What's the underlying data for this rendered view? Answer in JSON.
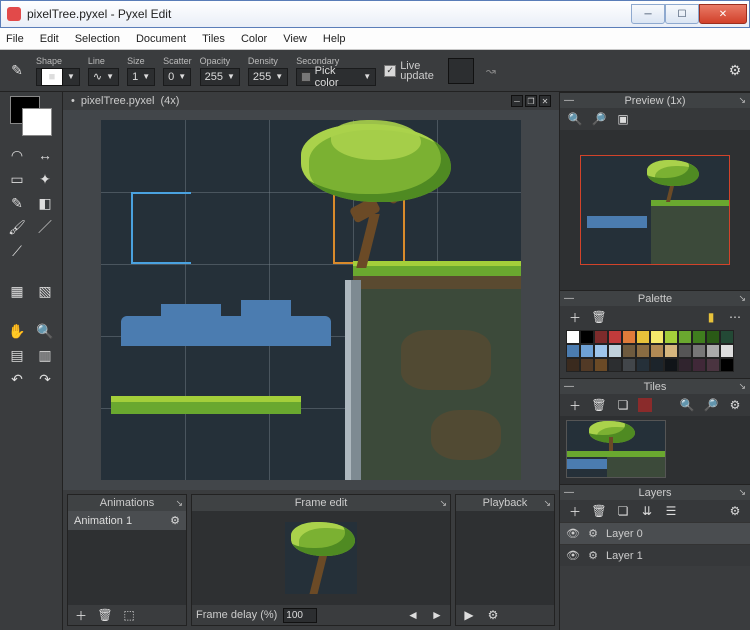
{
  "window": {
    "title": "pixelTree.pyxel - Pyxel Edit"
  },
  "menu": [
    "File",
    "Edit",
    "Selection",
    "Document",
    "Tiles",
    "Color",
    "View",
    "Help"
  ],
  "toolbar": {
    "shape_label": "Shape",
    "line_label": "Line",
    "size_label": "Size",
    "size_value": "1",
    "scatter_label": "Scatter",
    "scatter_value": "0",
    "opacity_label": "Opacity",
    "opacity_value": "255",
    "density_label": "Density",
    "density_value": "255",
    "secondary_label": "Secondary",
    "pick_color": "Pick color",
    "live": "Live",
    "update": "update"
  },
  "document_tab": {
    "name": "pixelTree.pyxel",
    "zoom": "(4x)",
    "dirty": "•"
  },
  "panels": {
    "animations": {
      "title": "Animations",
      "items": [
        "Animation 1"
      ]
    },
    "frame_edit": {
      "title": "Frame edit",
      "delay_label": "Frame delay (%)",
      "delay_value": "100"
    },
    "playback": {
      "title": "Playback"
    },
    "preview": {
      "title": "Preview (1x)"
    },
    "palette": {
      "title": "Palette",
      "colors": [
        "#ffffff",
        "#000000",
        "#7d2b2b",
        "#c23b3b",
        "#e07b3a",
        "#e8c23a",
        "#f6ea6b",
        "#a4cf3a",
        "#6aa82f",
        "#3f7d1e",
        "#2a5a16",
        "#234935",
        "#4b7cb0",
        "#6fa2d6",
        "#9ec5ea",
        "#c0d0da",
        "#6e5a3e",
        "#8a6c42",
        "#b28a54",
        "#d6b67e",
        "#555555",
        "#777777",
        "#aaaaaa",
        "#dddddd",
        "#3a2a1e",
        "#523a26",
        "#6b4a26",
        "#2c2e30",
        "#42464a",
        "#253039",
        "#1c242b",
        "#101418",
        "#30242e",
        "#402838",
        "#4a3440",
        "#000000"
      ]
    },
    "tiles": {
      "title": "Tiles"
    },
    "layers": {
      "title": "Layers",
      "items": [
        "Layer 0",
        "Layer 1"
      ]
    }
  }
}
